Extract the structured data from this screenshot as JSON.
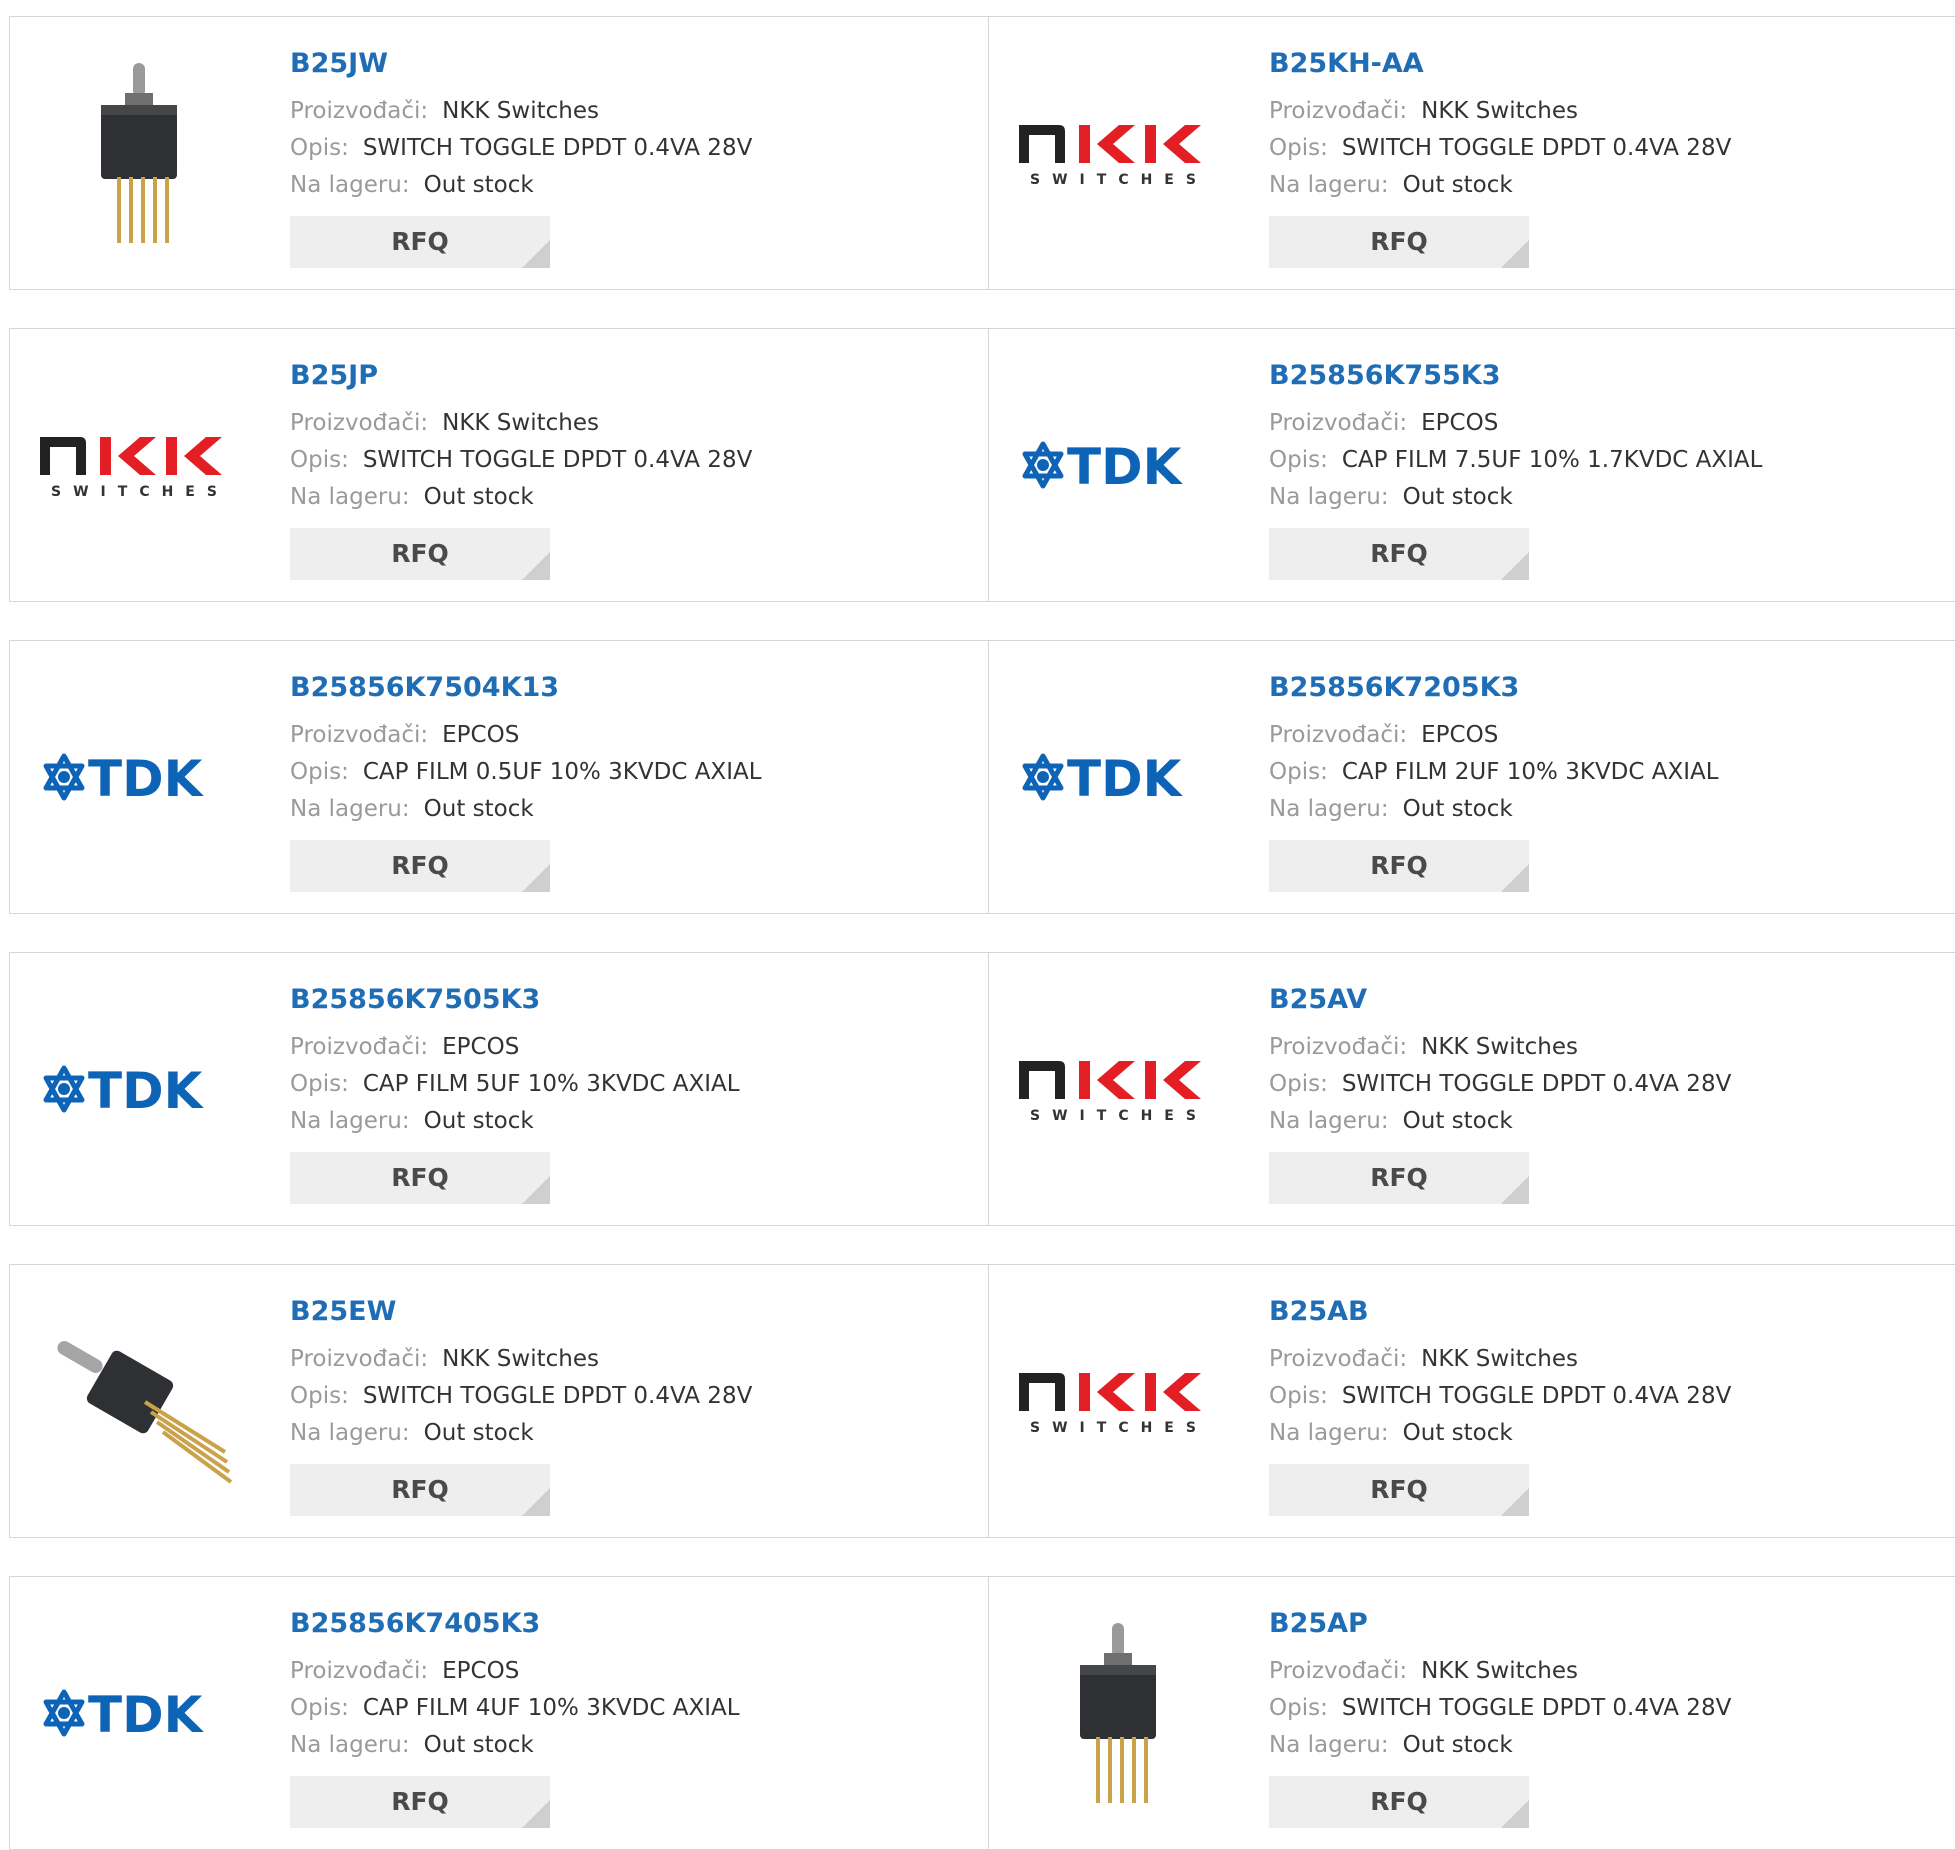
{
  "labels": {
    "manufacturer": "Proizvođači:",
    "description": "Opis:",
    "stock": "Na lageru:",
    "rfq": "RFQ"
  },
  "logos": {
    "nkk_main": "NKK",
    "nkk_sub": "SWITCHES",
    "tdk": "TDK"
  },
  "colors": {
    "link": "#1f6db5",
    "nkk_red": "#e31e24",
    "tdk_blue": "#0d63b5",
    "button_bg": "#eeeeee"
  },
  "rows": [
    [
      {
        "part": "B25JW",
        "manufacturer": "NKK Switches",
        "description": "SWITCH TOGGLE DPDT 0.4VA 28V",
        "stock": "Out stock",
        "image": "toggle-switch-photo"
      },
      {
        "part": "B25KH-AA",
        "manufacturer": "NKK Switches",
        "description": "SWITCH TOGGLE DPDT 0.4VA 28V",
        "stock": "Out stock",
        "image": "nkk-logo"
      }
    ],
    [
      {
        "part": "B25JP",
        "manufacturer": "NKK Switches",
        "description": "SWITCH TOGGLE DPDT 0.4VA 28V",
        "stock": "Out stock",
        "image": "nkk-logo"
      },
      {
        "part": "B25856K755K3",
        "manufacturer": "EPCOS",
        "description": "CAP FILM 7.5UF 10% 1.7KVDC AXIAL",
        "stock": "Out stock",
        "image": "tdk-logo"
      }
    ],
    [
      {
        "part": "B25856K7504K13",
        "manufacturer": "EPCOS",
        "description": "CAP FILM 0.5UF 10% 3KVDC AXIAL",
        "stock": "Out stock",
        "image": "tdk-logo"
      },
      {
        "part": "B25856K7205K3",
        "manufacturer": "EPCOS",
        "description": "CAP FILM 2UF 10% 3KVDC AXIAL",
        "stock": "Out stock",
        "image": "tdk-logo"
      }
    ],
    [
      {
        "part": "B25856K7505K3",
        "manufacturer": "EPCOS",
        "description": "CAP FILM 5UF 10% 3KVDC AXIAL",
        "stock": "Out stock",
        "image": "tdk-logo"
      },
      {
        "part": "B25AV",
        "manufacturer": "NKK Switches",
        "description": "SWITCH TOGGLE DPDT 0.4VA 28V",
        "stock": "Out stock",
        "image": "nkk-logo"
      }
    ],
    [
      {
        "part": "B25EW",
        "manufacturer": "NKK Switches",
        "description": "SWITCH TOGGLE DPDT 0.4VA 28V",
        "stock": "Out stock",
        "image": "toggle-switch-angled-photo"
      },
      {
        "part": "B25AB",
        "manufacturer": "NKK Switches",
        "description": "SWITCH TOGGLE DPDT 0.4VA 28V",
        "stock": "Out stock",
        "image": "nkk-logo"
      }
    ],
    [
      {
        "part": "B25856K7405K3",
        "manufacturer": "EPCOS",
        "description": "CAP FILM 4UF 10% 3KVDC AXIAL",
        "stock": "Out stock",
        "image": "tdk-logo"
      },
      {
        "part": "B25AP",
        "manufacturer": "NKK Switches",
        "description": "SWITCH TOGGLE DPDT 0.4VA 28V",
        "stock": "Out stock",
        "image": "toggle-switch-photo"
      }
    ]
  ]
}
